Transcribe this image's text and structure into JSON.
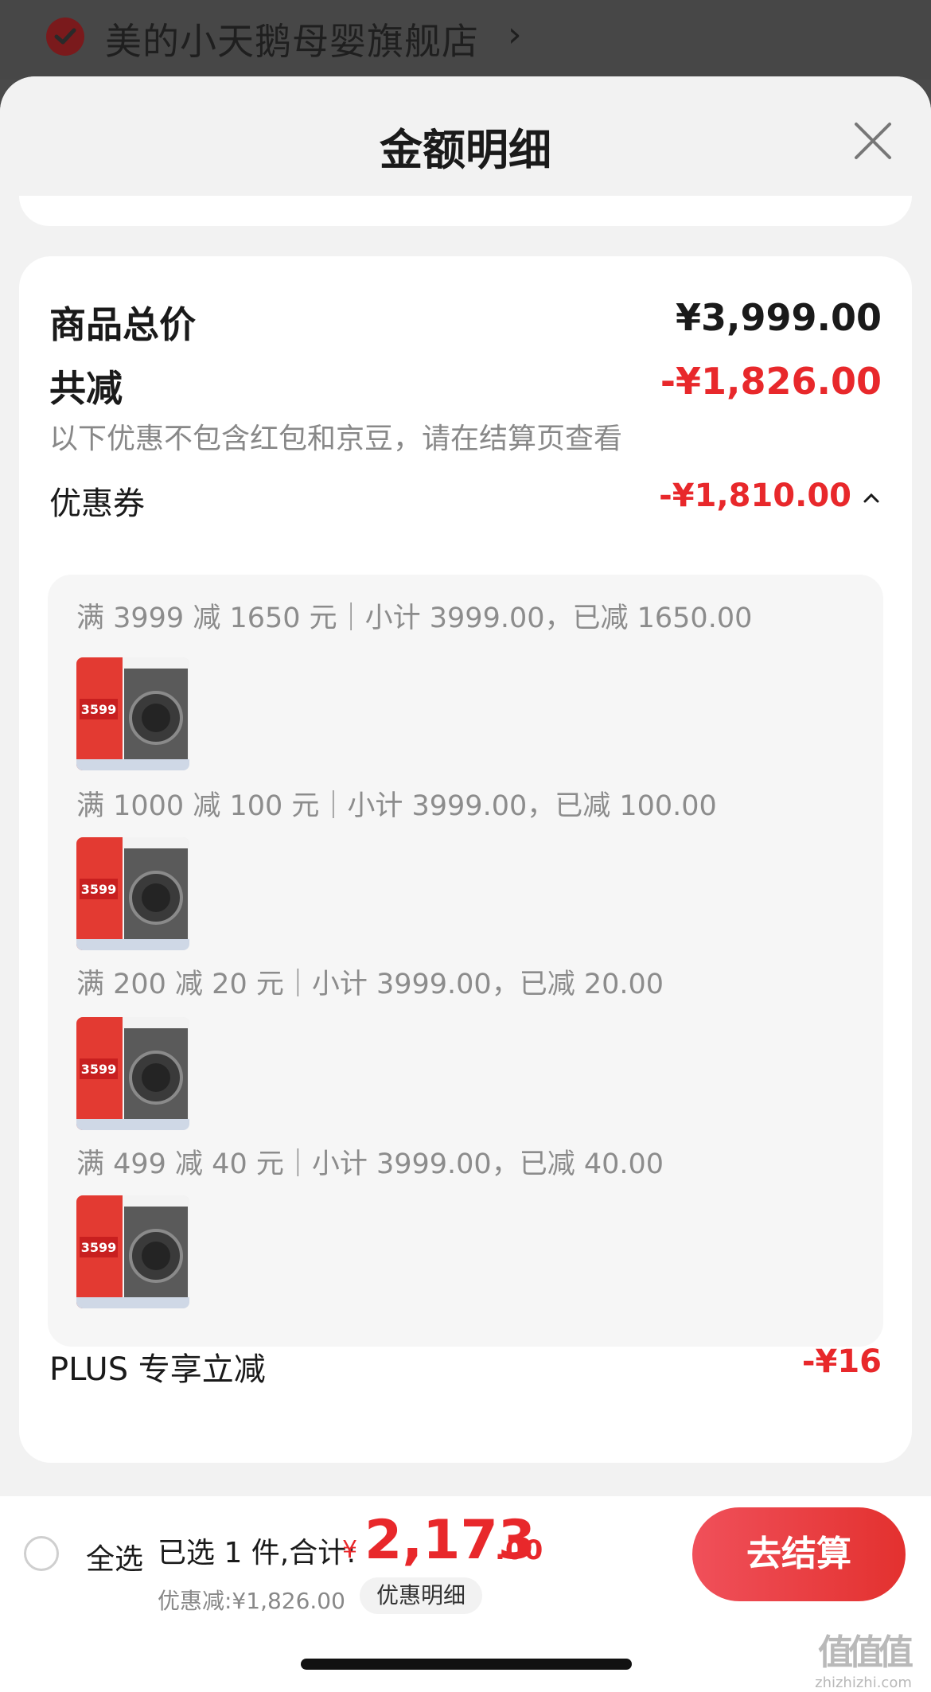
{
  "store": {
    "name": "美的小天鹅母婴旗舰店",
    "arrow": "›"
  },
  "sheet": {
    "title": "金额明细",
    "items_total": {
      "label": "商品总价",
      "value": "¥3,999.00"
    },
    "total_reduction": {
      "label": "共减",
      "value": "-¥1,826.00",
      "note": "以下优惠不包含红包和京豆，请在结算页查看"
    },
    "coupons": {
      "label": "优惠券",
      "value": "-¥1,810.00",
      "lines": [
        "满 3999 减 1650 元｜小计 3999.00，已减 1650.00",
        "满 1000 减 100 元｜小计 3999.00，已减 100.00",
        "满 200 减 20 元｜小计 3999.00，已减 20.00",
        "满 499 减 40 元｜小计 3999.00，已减 40.00"
      ],
      "thumb_price": "3599"
    },
    "plus": {
      "label": "PLUS 专享立减",
      "value": "-¥16"
    }
  },
  "bottom": {
    "select_all": "全选",
    "selected_count": "已选 1 件,合计:",
    "currency": "¥",
    "total_int": "2,173",
    "total_dec": ".00",
    "discount": "优惠减:¥1,826.00",
    "detail_link": "优惠明细",
    "checkout": "去结算"
  },
  "watermark": {
    "glyph": "值值值",
    "url": "zhizhizhi.com"
  },
  "colors": {
    "accent": "#e8282b",
    "sheet_bg": "#f2f2f2",
    "card_bg": "#ffffff",
    "muted": "#888888"
  }
}
